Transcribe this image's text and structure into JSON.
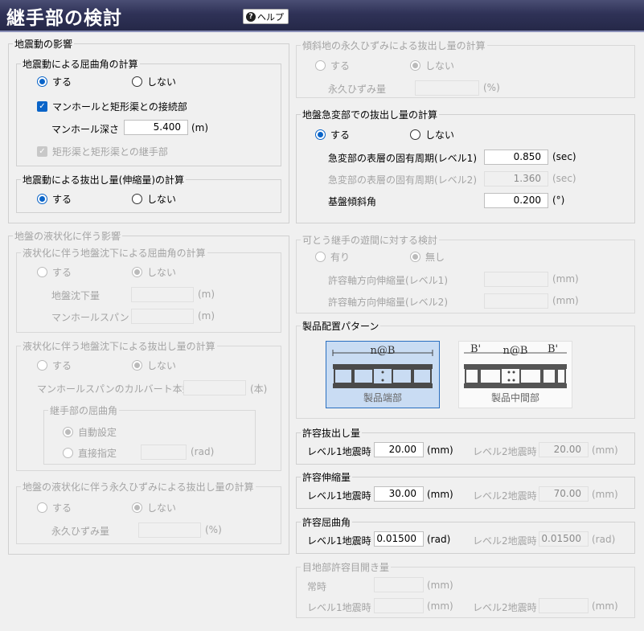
{
  "header": {
    "title": "継手部の検討",
    "help_label": "ヘルプ"
  },
  "quake": {
    "legend": "地震動の影響",
    "bend": {
      "legend": "地震動による屈曲角の計算",
      "opt_yes": "する",
      "opt_no": "しない",
      "manhole_check": "マンホールと矩形渠との接続部",
      "depth_label": "マンホール深さ",
      "depth_value": "5.400",
      "depth_unit": "(m)",
      "rect_check": "矩形渠と矩形渠との継手部"
    },
    "pull": {
      "legend": "地震動による抜出し量(伸縮量)の計算",
      "opt_yes": "する",
      "opt_no": "しない"
    }
  },
  "liquefaction": {
    "legend": "地盤の液状化に伴う影響",
    "bend": {
      "legend": "液状化に伴う地盤沈下による屈曲角の計算",
      "opt_yes": "する",
      "opt_no": "しない",
      "settle_label": "地盤沈下量",
      "settle_unit": "(m)",
      "span_label": "マンホールスパン",
      "span_unit": "(m)"
    },
    "pull": {
      "legend": "液状化に伴う地盤沈下による抜出し量の計算",
      "opt_yes": "する",
      "opt_no": "しない",
      "culvert_label": "マンホールスパンのカルバート本数",
      "culvert_unit": "(本)",
      "joint": {
        "legend": "継手部の屈曲角",
        "auto": "自動設定",
        "direct": "直接指定",
        "direct_unit": "(rad)"
      }
    },
    "perm": {
      "legend": "地盤の液状化に伴う永久ひずみによる抜出し量の計算",
      "opt_yes": "する",
      "opt_no": "しない",
      "strain_label": "永久ひずみ量",
      "strain_unit": "(%)"
    }
  },
  "slope": {
    "legend": "傾斜地の永久ひずみによる抜出し量の計算",
    "opt_yes": "する",
    "opt_no": "しない",
    "strain_label": "永久ひずみ量",
    "strain_unit": "(%)"
  },
  "abrupt": {
    "legend": "地盤急変部での抜出し量の計算",
    "opt_yes": "する",
    "opt_no": "しない",
    "period1_label": "急変部の表層の固有周期(レベル1)",
    "period1_value": "0.850",
    "period1_unit": "(sec)",
    "period2_label": "急変部の表層の固有周期(レベル2)",
    "period2_value": "1.360",
    "period2_unit": "(sec)",
    "slope_label": "基盤傾斜角",
    "slope_value": "0.200",
    "slope_unit": "(°)"
  },
  "flex": {
    "legend": "可とう継手の遊間に対する検討",
    "opt_yes": "有り",
    "opt_no": "無し",
    "l1_label": "許容軸方向伸縮量(レベル1)",
    "l1_unit": "(mm)",
    "l2_label": "許容軸方向伸縮量(レベル2)",
    "l2_unit": "(mm)"
  },
  "pattern": {
    "legend": "製品配置パターン",
    "end": {
      "label": "製品端部",
      "dim": "n@B"
    },
    "mid": {
      "label": "製品中間部",
      "dim": "n@B",
      "b_left": "B'",
      "b_right": "B'"
    }
  },
  "allow_pull": {
    "title": "許容抜出し量",
    "l1_label": "レベル1地震時",
    "l1_value": "20.00",
    "l1_unit": "(mm)",
    "l2_label": "レベル2地震時",
    "l2_value": "20.00",
    "l2_unit": "(mm)"
  },
  "allow_stretch": {
    "title": "許容伸縮量",
    "l1_label": "レベル1地震時",
    "l1_value": "30.00",
    "l1_unit": "(mm)",
    "l2_label": "レベル2地震時",
    "l2_value": "70.00",
    "l2_unit": "(mm)"
  },
  "allow_bend": {
    "title": "許容屈曲角",
    "l1_label": "レベル1地震時",
    "l1_value": "0.01500",
    "l1_unit": "(rad)",
    "l2_label": "レベル2地震時",
    "l2_value": "0.01500",
    "l2_unit": "(rad)"
  },
  "joint_gap": {
    "legend": "目地部許容目開き量",
    "normal_label": "常時",
    "normal_unit": "(mm)",
    "l1_label": "レベル1地震時",
    "l1_unit": "(mm)",
    "l2_label": "レベル2地震時",
    "l2_unit": "(mm)"
  }
}
